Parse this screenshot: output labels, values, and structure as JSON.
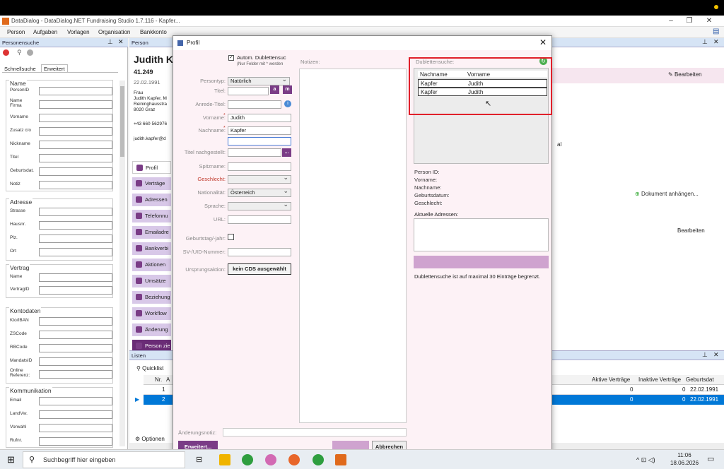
{
  "window": {
    "title": "DataDialog - DataDialog.NET Fundraising Studio 1.7.116 - Kapfer..."
  },
  "menu": [
    "Person",
    "Aufgaben",
    "Vorlagen",
    "Organisation",
    "Bankkonto"
  ],
  "left_panel": {
    "header": "Personensuche",
    "tabs": [
      "Schnellsuche",
      "Erweitert"
    ],
    "groups": {
      "name": {
        "title": "Name",
        "fields": [
          "PersonID",
          "Name\nFirma",
          "Vorname",
          "Zusatz c/o",
          "Nickname",
          "Titel",
          "Geburtsdat.",
          "Notiz"
        ]
      },
      "adresse": {
        "title": "Adresse",
        "fields": [
          "Strasse",
          "Hausnr.",
          "Plz.",
          "Ort"
        ]
      },
      "vertrag": {
        "title": "Vertrag",
        "fields": [
          "Name",
          "VertragID"
        ]
      },
      "konto": {
        "title": "Kontodaten",
        "fields": [
          "Kto/IBAN",
          "ZSCode",
          "RBCode",
          "MandatsID",
          "Online\nReferenz:"
        ]
      },
      "komm": {
        "title": "Kommunikation",
        "fields": [
          "Email",
          "LandVw.",
          "Vorwahl",
          "Rufnr."
        ]
      }
    }
  },
  "center_panel": {
    "header": "Person",
    "person_name": "Judith K",
    "person_id": "41.249",
    "birth": "22.02.1991",
    "address": [
      "Frau",
      "Judith Kapfer, M",
      "Reininghausstra",
      "8020 Graz"
    ],
    "phone": "+43 660 562976",
    "email": "judith.kapfer@d",
    "edit_label": "Bearbeiten",
    "attach_label": "Dokument anhängen...",
    "edit2_label": "Bearbeiten",
    "fragment": "al",
    "side_buttons": [
      "Profil",
      "Verträge",
      "Adressen",
      "Telefonnu",
      "Emailadre",
      "Bankverbi",
      "Aktionen",
      "Umsätze",
      "Beziehung",
      "Workflow",
      "Änderung",
      "Person zie"
    ]
  },
  "list_panel": {
    "header": "Listen",
    "tab": "Quicklist",
    "columns": [
      "Nr.",
      "A",
      "Aktive Verträge",
      "Inaktive Verträge",
      "Geburtsdat"
    ],
    "rows": [
      {
        "nr": "1",
        "aktiv": "0",
        "inaktiv": "0",
        "geb": "22.02.1991"
      },
      {
        "nr": "2",
        "aktiv": "0",
        "inaktiv": "0",
        "geb": "22.02.1991"
      }
    ],
    "options_label": "Optionen"
  },
  "dialog": {
    "title": "Profil",
    "dup_check_label": "Autom. Dublettensuc",
    "dup_hint": "(Nur Felder mit * werden",
    "notes_label": "Notizen:",
    "fields": {
      "persontyp": {
        "label": "Persontyp:",
        "value": "Natürlich"
      },
      "titel": {
        "label": "Titel:",
        "value": ""
      },
      "anrede": {
        "label": "Anrede-Titel:",
        "value": ""
      },
      "vorname": {
        "label": "Vorname:",
        "value": "Judith"
      },
      "nachname": {
        "label": "Nachname:",
        "value": "Kapfer"
      },
      "titel_nach": {
        "label": "Titel nachgestellt:",
        "value": ""
      },
      "spitzname": {
        "label": "Spitzname:",
        "value": ""
      },
      "geschlecht": {
        "label": "Geschlecht:",
        "value": ""
      },
      "nationalitaet": {
        "label": "Nationalität:",
        "value": "Österreich"
      },
      "sprache": {
        "label": "Sprache:",
        "value": ""
      },
      "url": {
        "label": "URL:",
        "value": ""
      },
      "geburtstag": {
        "label": "Geburtstag/-jahr:"
      },
      "sv": {
        "label": "SV-/UID-Nummer:",
        "value": ""
      },
      "ursprung": {
        "label": "Ursprungsaktion:",
        "value": "kein CDS ausgewählt"
      }
    },
    "titel_btn_a": "a",
    "titel_btn_b": "m",
    "titel_nach_btn": "...",
    "dup": {
      "title": "Dublettensuche:",
      "columns": [
        "Nachname",
        "Vorname"
      ],
      "rows": [
        [
          "Kapfer",
          "Judith"
        ],
        [
          "Kapfer",
          "Judith"
        ]
      ]
    },
    "details": [
      "Person ID:",
      "Vorname:",
      "Nachname:",
      "Geburtsdatum:",
      "Geschlecht:"
    ],
    "addresses_label": "Aktuelle Adressen:",
    "dup_limit": "Dublettensuche ist auf maximal 30 Einträge begrenzt.",
    "aenderung_label": "Änderungsnotiz:",
    "btn_more": "Erweitert...",
    "btn_abort": "Abbrechen"
  },
  "taskbar": {
    "search_placeholder": "Suchbegriff hier eingeben",
    "time": "11:06",
    "date": "18.06.2026"
  },
  "colors": {
    "accent": "#7a3c86",
    "highlight": "#e0202a",
    "selection": "#0078d7"
  }
}
